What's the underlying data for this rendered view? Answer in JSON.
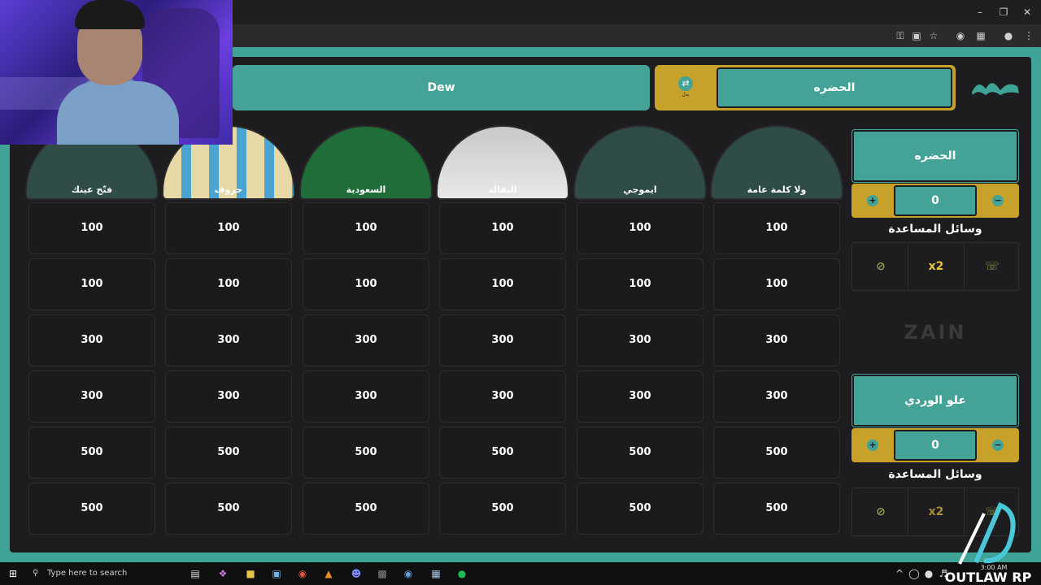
{
  "app": {
    "team_top_left": "Dew",
    "team_top_right": "الحضره",
    "swap_label": "بدل",
    "categories": [
      {
        "id": "trivia",
        "label": "ولا كلمة عامة"
      },
      {
        "id": "emoji",
        "label": "ايموجي"
      },
      {
        "id": "grocery",
        "label": "البقالة"
      },
      {
        "id": "saudi",
        "label": "السعودية"
      },
      {
        "id": "letters",
        "label": "حروف"
      },
      {
        "id": "eye",
        "label": "فتّح عينك"
      }
    ],
    "board_values": [
      [
        "100",
        "100",
        "100",
        "100",
        "100",
        "100"
      ],
      [
        "100",
        "100",
        "100",
        "100",
        "100",
        "100"
      ],
      [
        "300",
        "300",
        "300",
        "300",
        "300",
        "300"
      ],
      [
        "300",
        "300",
        "300",
        "300",
        "300",
        "300"
      ],
      [
        "500",
        "500",
        "500",
        "500",
        "500",
        "500"
      ],
      [
        "500",
        "500",
        "500",
        "500",
        "500",
        "500"
      ]
    ],
    "sidebar": {
      "team1": {
        "name": "الحضره",
        "score": "0",
        "aids_title": "وسائل المساعدة"
      },
      "team2": {
        "name": "علو الوردي",
        "score": "0",
        "aids_title": "وسائل المساعدة"
      },
      "aid_double": "x2",
      "sponsor": "ZAIN"
    }
  },
  "taskbar": {
    "search_placeholder": "Type here to search",
    "time": "3:00 AM"
  },
  "watermark": "OUTLAW RP",
  "colors": {
    "teal": "#44a296",
    "gold": "#c7a22a",
    "board_bg": "#1d1d1f",
    "cell_bg": "#1b1b1b"
  }
}
